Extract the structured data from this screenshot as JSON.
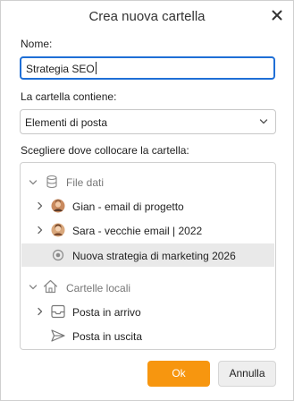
{
  "dialog": {
    "title": "Crea nuova cartella",
    "close_icon": "close-icon"
  },
  "name_field": {
    "label": "Nome:",
    "value": "Strategia SEO"
  },
  "contains_field": {
    "label": "La cartella contiene:",
    "selected": "Elementi di posta"
  },
  "location": {
    "label": "Scegliere dove collocare la cartella:",
    "tree": [
      {
        "label": "File dati",
        "icon": "database-icon",
        "expanded": true,
        "muted": true
      },
      {
        "label": "Gian - email di progetto",
        "icon": "avatar-icon",
        "expanded": false
      },
      {
        "label": "Sara - vecchie email | 2022",
        "icon": "avatar-icon",
        "expanded": false
      },
      {
        "label": "Nuova strategia di marketing 2026",
        "icon": "radio-icon",
        "selected": true
      },
      {
        "label": "Cartelle locali",
        "icon": "home-icon",
        "expanded": true,
        "muted": true
      },
      {
        "label": "Posta in arrivo",
        "icon": "inbox-icon",
        "expanded": false
      },
      {
        "label": "Posta in uscita",
        "icon": "send-icon"
      }
    ]
  },
  "buttons": {
    "ok": "Ok",
    "cancel": "Annulla"
  },
  "colors": {
    "accent": "#f7960f",
    "focus": "#1f6fd6",
    "selected_row": "#e9e9e9"
  }
}
